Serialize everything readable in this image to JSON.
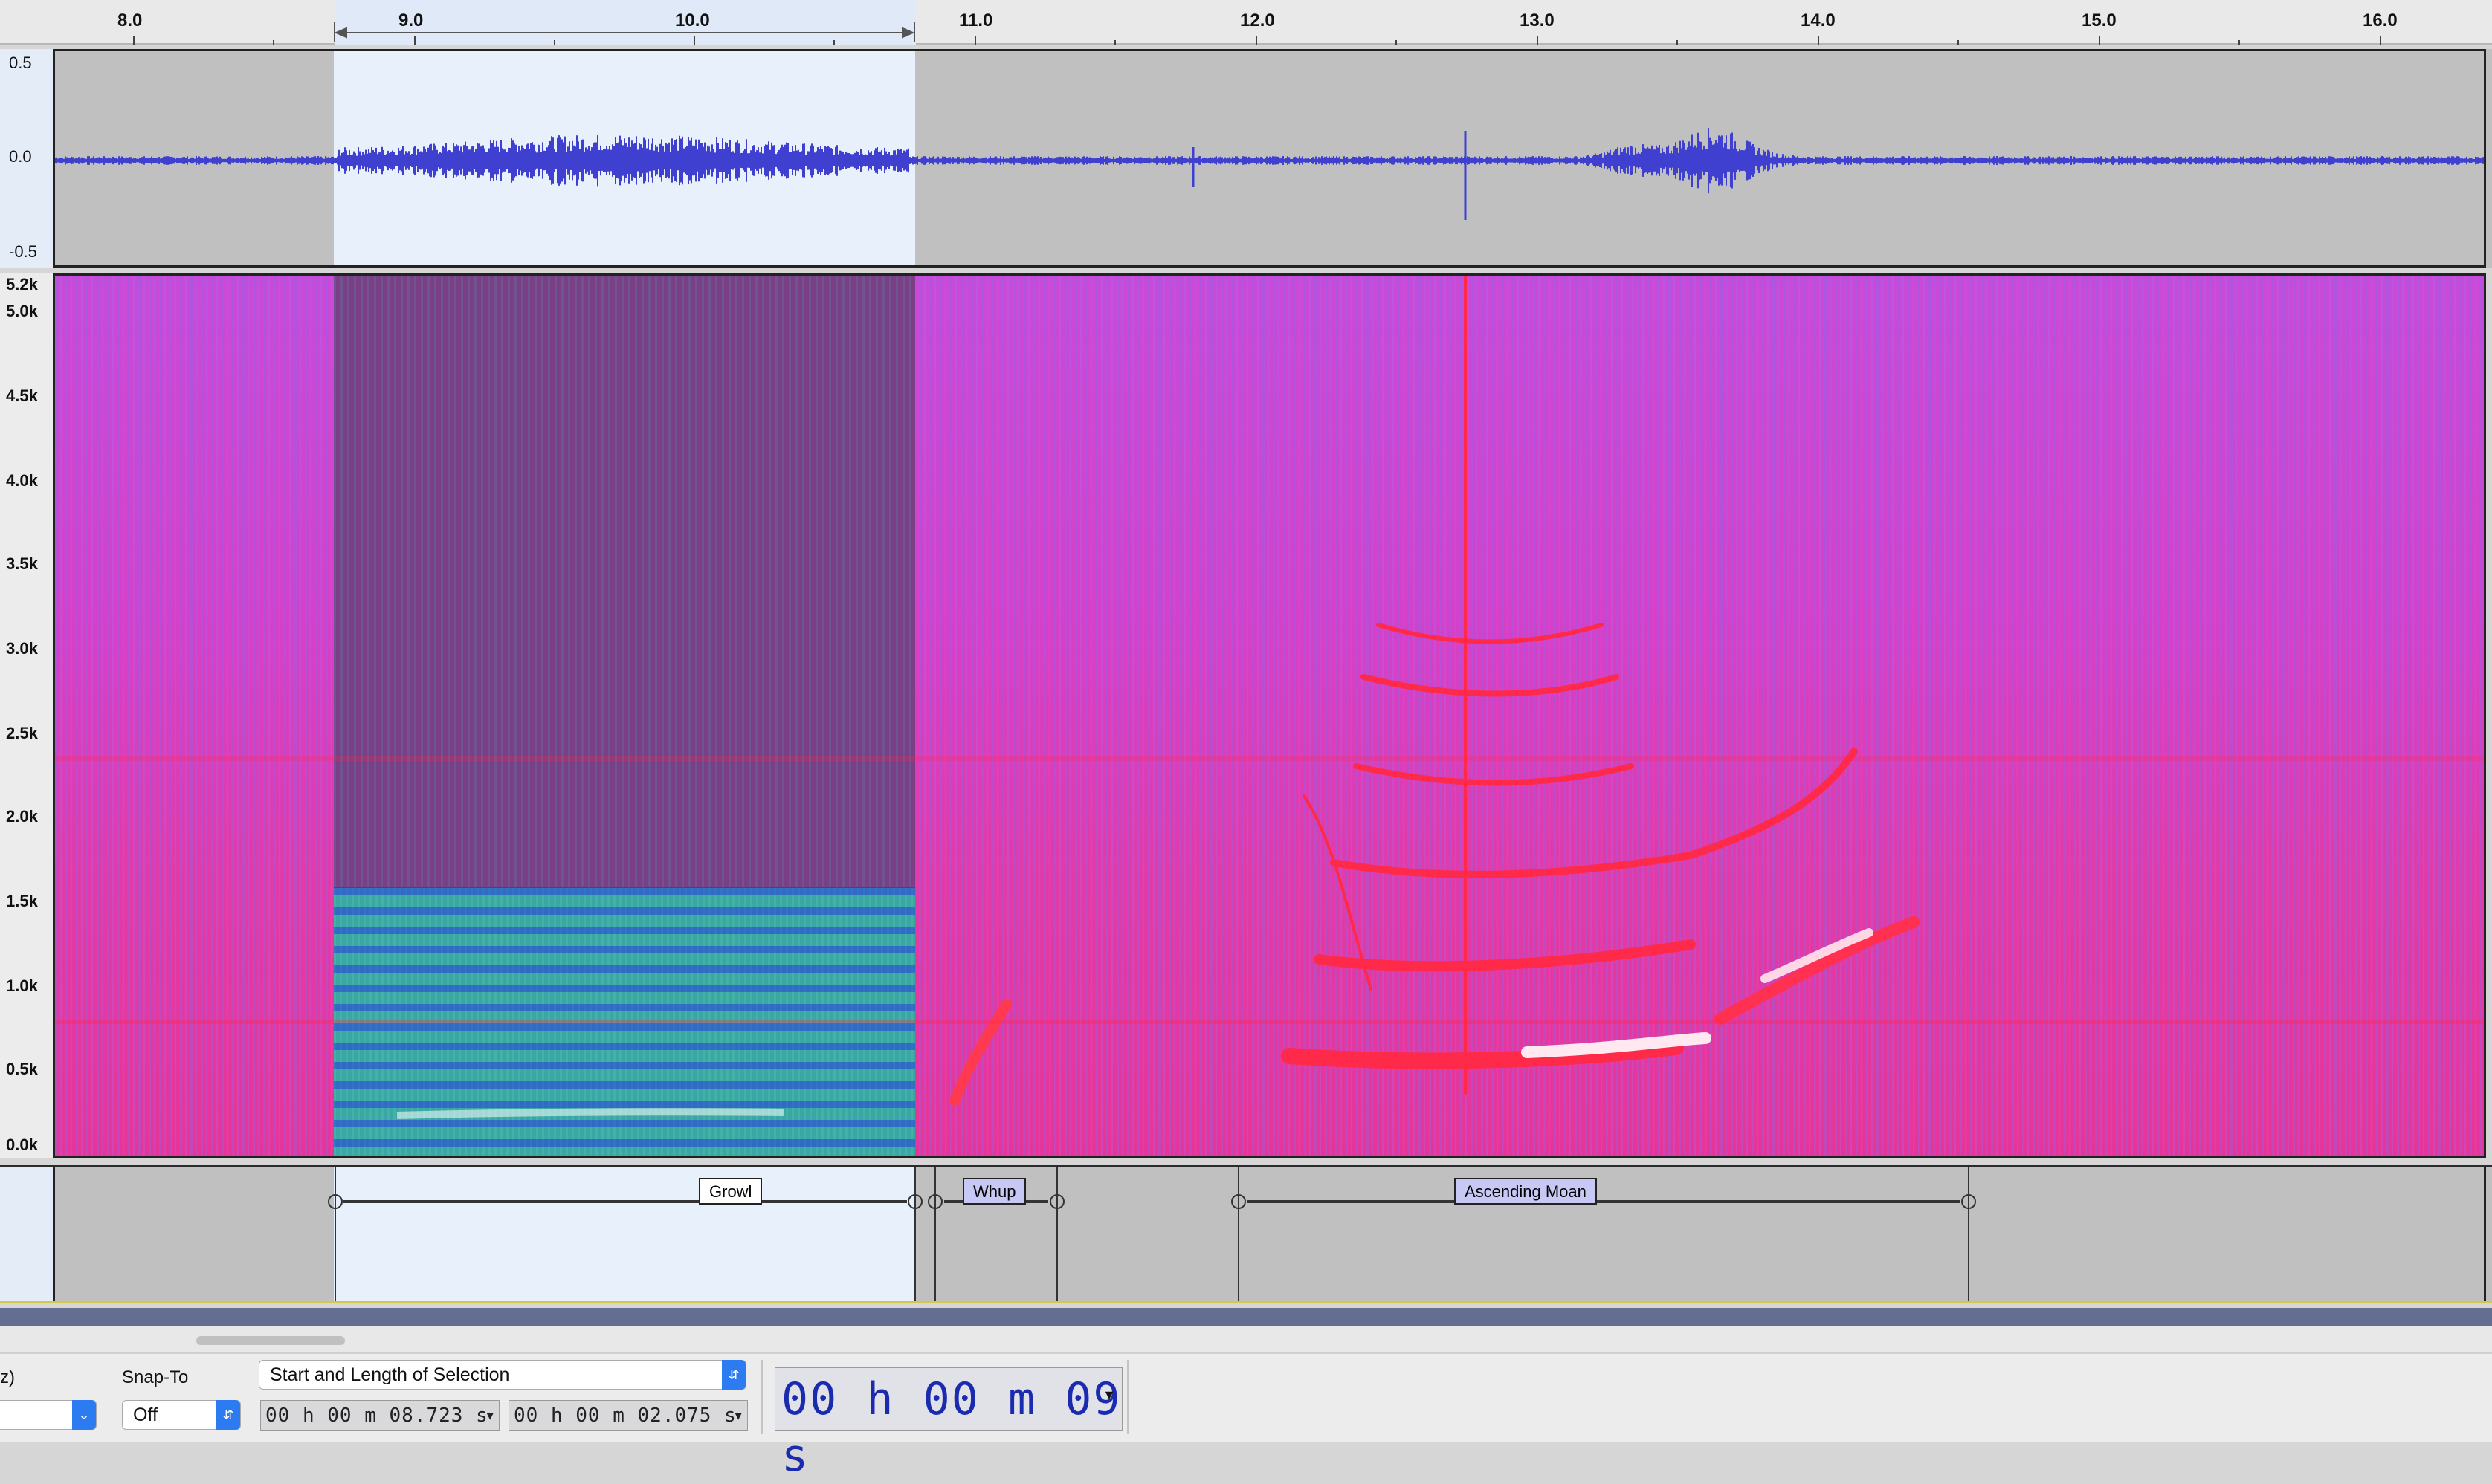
{
  "ruler": {
    "ticks": [
      "8.0",
      "9.0",
      "10.0",
      "11.0",
      "12.0",
      "13.0",
      "14.0",
      "15.0",
      "16.0"
    ]
  },
  "waveform": {
    "scale": [
      "0.5",
      "0.0",
      "-0.5"
    ],
    "color": "#3f3fd0"
  },
  "spectrogram": {
    "freq_labels": [
      "5.2k",
      "5.0k",
      "4.5k",
      "4.0k",
      "3.5k",
      "3.0k",
      "2.5k",
      "2.0k",
      "1.5k",
      "1.0k",
      "0.5k",
      "0.0k"
    ]
  },
  "labels": [
    {
      "text": "Growl",
      "selected": true
    },
    {
      "text": "Whup",
      "selected": false
    },
    {
      "text": "Ascending Moan",
      "selected": false
    }
  ],
  "selection_toolbar": {
    "rate_suffix": "z)",
    "snap_to_label": "Snap-To",
    "snap_to_value": "Off",
    "selection_mode": "Start and Length of Selection",
    "start_time": "00 h 00 m 08.723 s",
    "length_time": "00 h 00 m 02.075 s",
    "audio_position": "00 h 00 m 09 s"
  },
  "colors": {
    "selection": "#e8f0fb",
    "track_bg": "#c0c0c0",
    "accent": "#2d7bf0",
    "time_digits": "#1a2bb0"
  }
}
